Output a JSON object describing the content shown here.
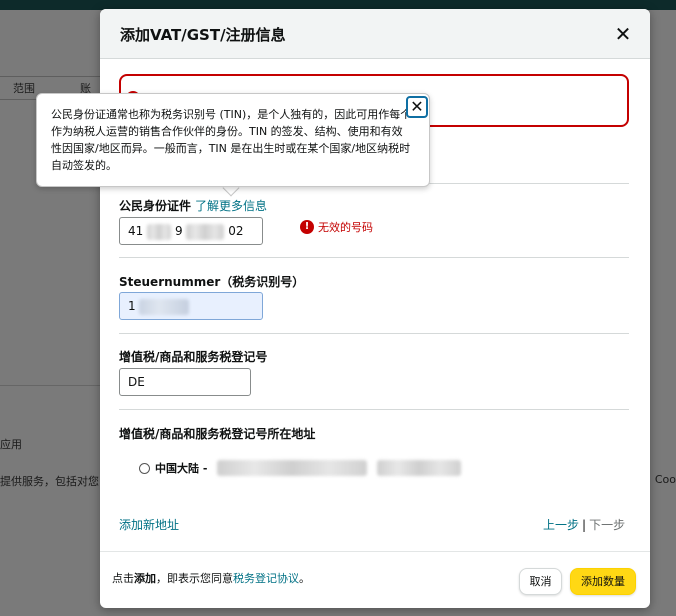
{
  "background": {
    "table_headers": [
      "范围",
      "账"
    ],
    "app_section": "应用",
    "service_text": "提供服务，包括对您",
    "right_snippet": "Coo"
  },
  "modal": {
    "title": "添加VAT/GST/注册信息",
    "tooltip": {
      "text": "公民身份证通常也称为税务识别号 (TIN)，是个人独有的，因此可用作每个作为纳税人运营的销售合作伙伴的身份。TIN 的签发、结构、使用和有效性因国家/地区而异。一般而言，TIN 是在出生时或在某个国家/地区纳税时自动签发的。"
    },
    "national_id": {
      "label": "公民身份证件",
      "learn_more": "了解更多信息",
      "value_prefix": "41",
      "value_mid": "9",
      "value_suffix": "02",
      "error": "无效的号码"
    },
    "tax_number": {
      "label": "Steuernummer（税务识别号）",
      "value_prefix": "1"
    },
    "vat_number": {
      "label": "增值税/商品和服务税登记号",
      "value": "DE"
    },
    "address": {
      "label": "增值税/商品和服务税登记号所在地址",
      "option_label": "中国大陆 -"
    },
    "add_address": "添加新地址",
    "pager": {
      "prev": "上一步",
      "separator": "|",
      "next": "下一步"
    },
    "footer": {
      "prefix": "点击",
      "bold": "添加",
      "middle": "，即表示您同意",
      "link": "税务登记协议",
      "suffix": "。"
    },
    "buttons": {
      "cancel": "取消",
      "add": "添加数量"
    }
  }
}
